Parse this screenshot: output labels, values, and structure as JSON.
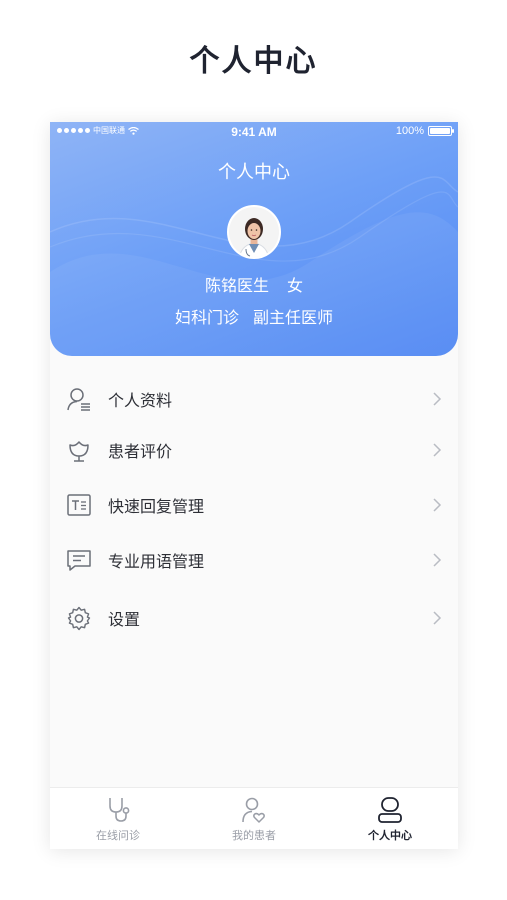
{
  "page_title": "个人中心",
  "status_bar": {
    "carrier": "中国联通",
    "time": "9:41 AM",
    "battery": "100%",
    "battery_level": 1.0
  },
  "header": {
    "title": "个人中心",
    "doctor_name": "陈铭医生",
    "gender": "女",
    "department": "妇科门诊",
    "position": "副主任医师"
  },
  "menu": {
    "items": [
      {
        "label": "个人资料",
        "icon": "user-profile-icon"
      },
      {
        "label": "患者评价",
        "icon": "flower-review-icon"
      },
      {
        "label": "快速回复管理",
        "icon": "text-template-icon"
      },
      {
        "label": "专业用语管理",
        "icon": "chat-message-icon"
      },
      {
        "label": "设置",
        "icon": "gear-icon"
      }
    ]
  },
  "tabbar": {
    "tabs": [
      {
        "label": "在线问诊",
        "icon": "stethoscope-icon",
        "active": false
      },
      {
        "label": "我的患者",
        "icon": "patient-heart-icon",
        "active": false
      },
      {
        "label": "个人中心",
        "icon": "person-icon",
        "active": true
      }
    ]
  },
  "colors": {
    "header_gradient_start": "#8fb4f6",
    "header_gradient_end": "#4f87f3",
    "text_dark": "#2d2f36",
    "tab_inactive": "#9a9ea7"
  }
}
